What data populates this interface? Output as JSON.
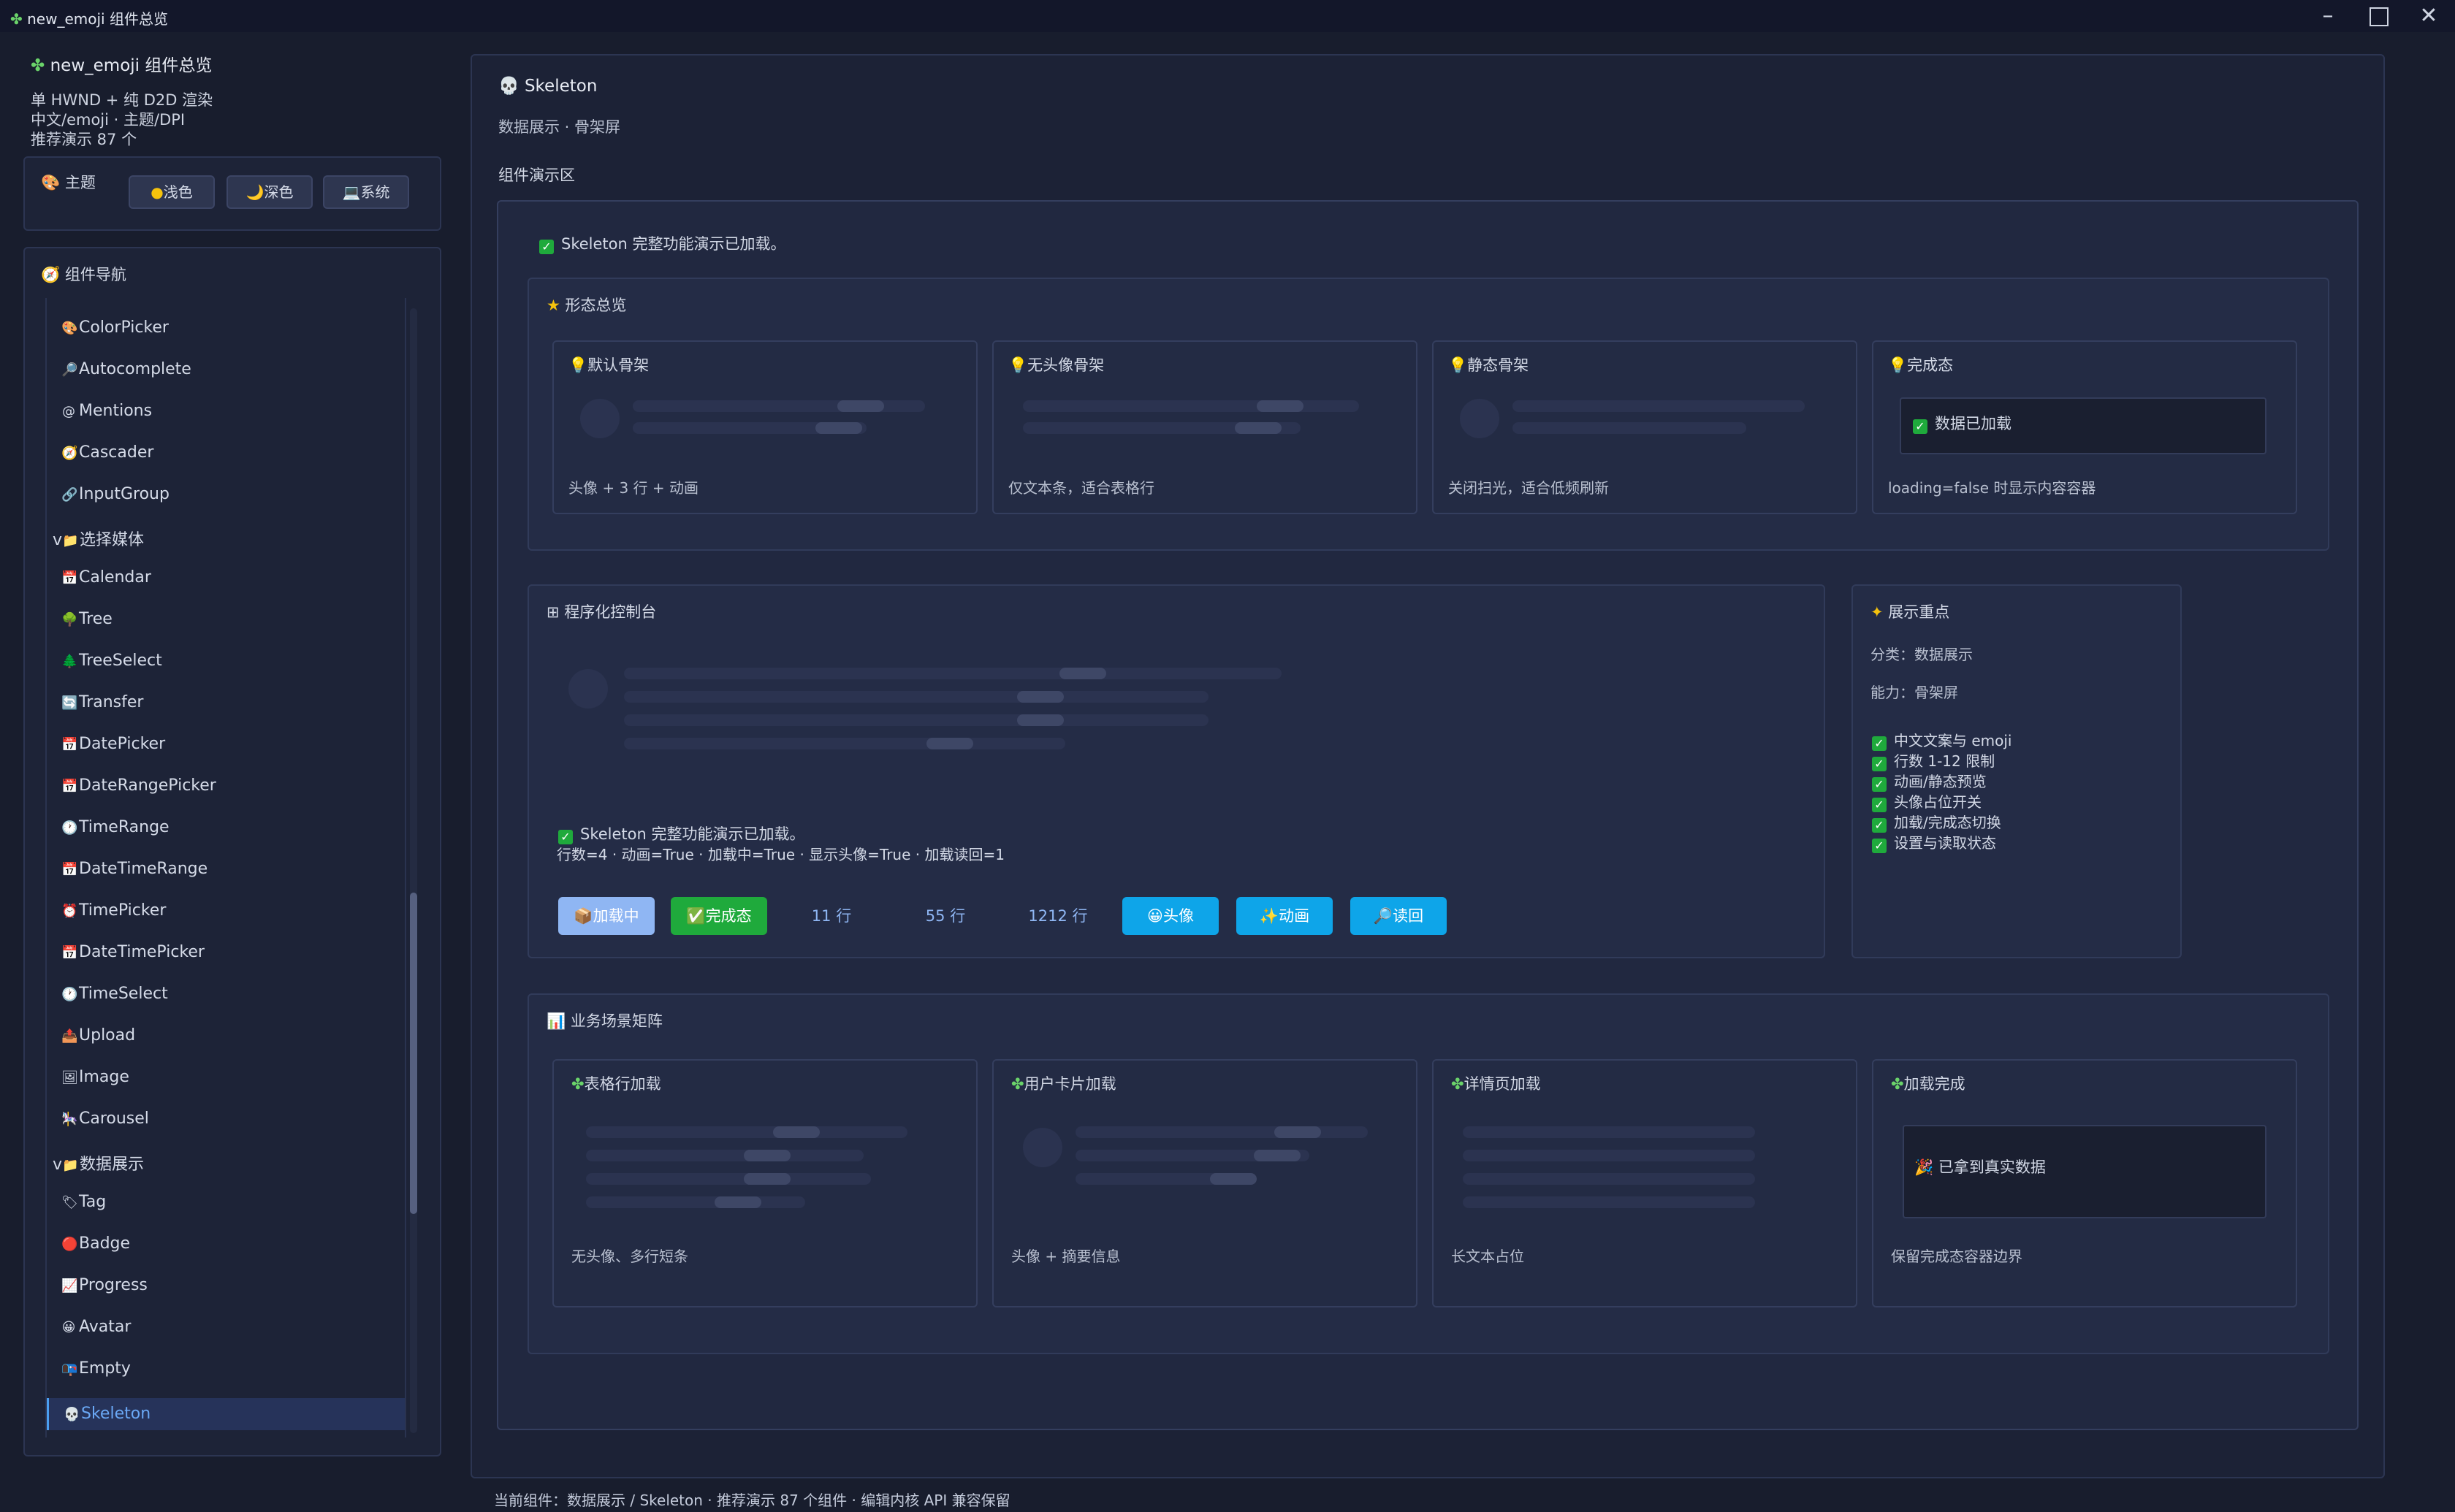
{
  "window": {
    "title": "new_emoji 组件总览"
  },
  "sidebar": {
    "title": "new_emoji 组件总览",
    "info": [
      "单 HWND + 纯 D2D 渲染",
      "中文/emoji · 主题/DPI",
      "推荐演示 87 个"
    ],
    "theme_label": "主题",
    "theme_buttons": [
      "浅色",
      "深色",
      "系统"
    ],
    "nav_title": "组件导航",
    "nav_items": [
      {
        "icon": "🎨",
        "label": "ColorPicker"
      },
      {
        "icon": "🔎",
        "label": "Autocomplete"
      },
      {
        "icon": "@",
        "label": "Mentions"
      },
      {
        "icon": "🧭",
        "label": "Cascader"
      },
      {
        "icon": "🔗",
        "label": "InputGroup"
      },
      {
        "icon": "📁",
        "label": "选择媒体",
        "group": true
      },
      {
        "icon": "📅",
        "label": "Calendar"
      },
      {
        "icon": "🌳",
        "label": "Tree"
      },
      {
        "icon": "🌲",
        "label": "TreeSelect"
      },
      {
        "icon": "🔄",
        "label": "Transfer"
      },
      {
        "icon": "📅",
        "label": "DatePicker"
      },
      {
        "icon": "📅",
        "label": "DateRangePicker"
      },
      {
        "icon": "🕐",
        "label": "TimeRange"
      },
      {
        "icon": "📅",
        "label": "DateTimeRange"
      },
      {
        "icon": "⏰",
        "label": "TimePicker"
      },
      {
        "icon": "📅",
        "label": "DateTimePicker"
      },
      {
        "icon": "🕐",
        "label": "TimeSelect"
      },
      {
        "icon": "📤",
        "label": "Upload"
      },
      {
        "icon": "🖼",
        "label": "Image"
      },
      {
        "icon": "🎠",
        "label": "Carousel"
      },
      {
        "icon": "📁",
        "label": "数据展示",
        "group": true
      },
      {
        "icon": "🏷",
        "label": "Tag"
      },
      {
        "icon": "🔴",
        "label": "Badge"
      },
      {
        "icon": "📈",
        "label": "Progress"
      },
      {
        "icon": "😀",
        "label": "Avatar"
      },
      {
        "icon": "📭",
        "label": "Empty"
      },
      {
        "icon": "💀",
        "label": "Skeleton",
        "selected": true
      }
    ]
  },
  "main": {
    "title": "Skeleton",
    "subtitle": "数据展示 · 骨架屏",
    "demo_label": "组件演示区",
    "loaded_msg": "Skeleton 完整功能演示已加载。",
    "overview": {
      "title": "形态总览",
      "cards": [
        {
          "title": "默认骨架",
          "desc": "头像 + 3 行 + 动画"
        },
        {
          "title": "无头像骨架",
          "desc": "仅文本条，适合表格行"
        },
        {
          "title": "静态骨架",
          "desc": "关闭扫光，适合低频刷新"
        },
        {
          "title": "完成态",
          "desc": "loading=false 时显示内容容器",
          "content": "数据已加载"
        }
      ]
    },
    "console": {
      "title": "程序化控制台",
      "msg": "Skeleton 完整功能演示已加载。",
      "status": "行数=4 · 动画=True · 加载中=True · 显示头像=True · 加载读回=1",
      "buttons": {
        "loading": "加载中",
        "done": "完成态",
        "rows1": "1 行",
        "rows5": "5 行",
        "rows12": "12 行",
        "avatar": "头像",
        "anim": "动画",
        "read": "读回"
      }
    },
    "focus": {
      "title": "展示重点",
      "category": "分类：数据展示",
      "ability": "能力：骨架屏",
      "items": [
        "中文文案与 emoji",
        "行数 1-12 限制",
        "动画/静态预览",
        "头像占位开关",
        "加载/完成态切换",
        "设置与读取状态"
      ]
    },
    "matrix": {
      "title": "业务场景矩阵",
      "cards": [
        {
          "title": "表格行加载",
          "desc": "无头像、多行短条"
        },
        {
          "title": "用户卡片加载",
          "desc": "头像 + 摘要信息"
        },
        {
          "title": "详情页加载",
          "desc": "长文本占位"
        },
        {
          "title": "加载完成",
          "desc": "保留完成态容器边界",
          "content": "已拿到真实数据"
        }
      ]
    }
  },
  "status_bar": "当前组件：数据展示 / Skeleton · 推荐演示 87 个组件 · 编辑内核 API 兼容保留",
  "colors": {
    "accent": "#4a9ff0",
    "success": "#1faa3c",
    "background": "#181d2d"
  }
}
